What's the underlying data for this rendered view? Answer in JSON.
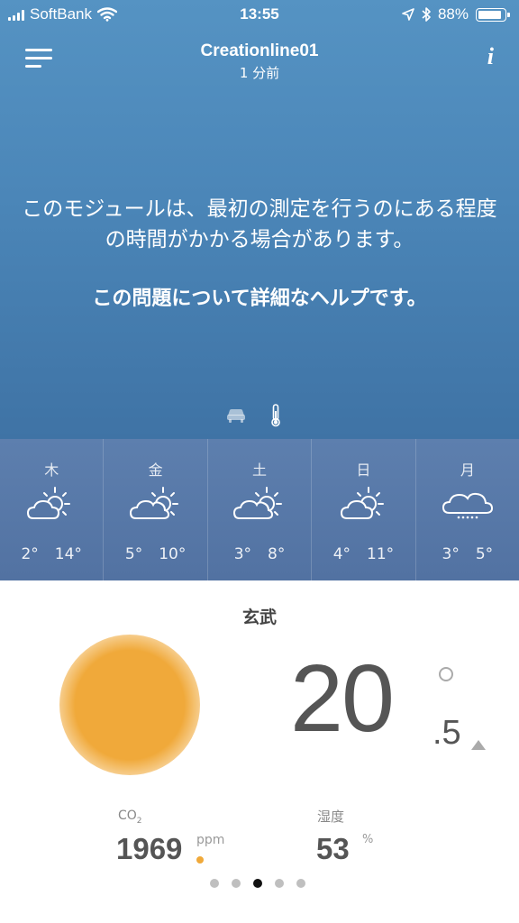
{
  "status_bar": {
    "carrier": "SoftBank",
    "time": "13:55",
    "battery": "88%",
    "battery_level": 0.88,
    "icons": [
      "signal-icon",
      "wifi-icon",
      "location-arrow-icon",
      "bluetooth-icon",
      "battery-icon"
    ]
  },
  "header": {
    "title": "Creationline01",
    "subtitle": "1 分前",
    "menu_icon": "hamburger-menu-icon",
    "info_icon": "info-icon",
    "info_label": "i"
  },
  "message": {
    "body": "このモジュールは、最初の測定を行うのにある程度の時間がかかる場合があります。",
    "help_link": "この問題について詳細なヘルプです。"
  },
  "mode_icons": [
    "car-icon",
    "thermometer-icon"
  ],
  "forecast": [
    {
      "day": "木",
      "icon": "partly-cloudy-icon",
      "low": "2°",
      "high": "14°"
    },
    {
      "day": "金",
      "icon": "partly-cloudy-icon",
      "low": "5°",
      "high": "10°"
    },
    {
      "day": "土",
      "icon": "partly-cloudy-icon",
      "low": "3°",
      "high": "8°"
    },
    {
      "day": "日",
      "icon": "partly-cloudy-icon",
      "low": "4°",
      "high": "11°"
    },
    {
      "day": "月",
      "icon": "cloudy-drizzle-icon",
      "low": "3°",
      "high": "5°"
    }
  ],
  "module": {
    "name": "玄武",
    "temperature_integer": "20",
    "temperature_decimal": ".5",
    "co2_label": "CO",
    "co2_label_sub": "2",
    "co2_value": "1969",
    "co2_unit": "ppm",
    "humidity_label": "湿度",
    "humidity_value": "53",
    "humidity_unit": "%"
  },
  "colors": {
    "sun": "#f0a93a",
    "co2_indicator": "#f0a93a",
    "top_gradient": "#4b86b8",
    "forecast_bg": "#5677a6"
  },
  "pagination": {
    "count": 5,
    "active_index": 2
  }
}
